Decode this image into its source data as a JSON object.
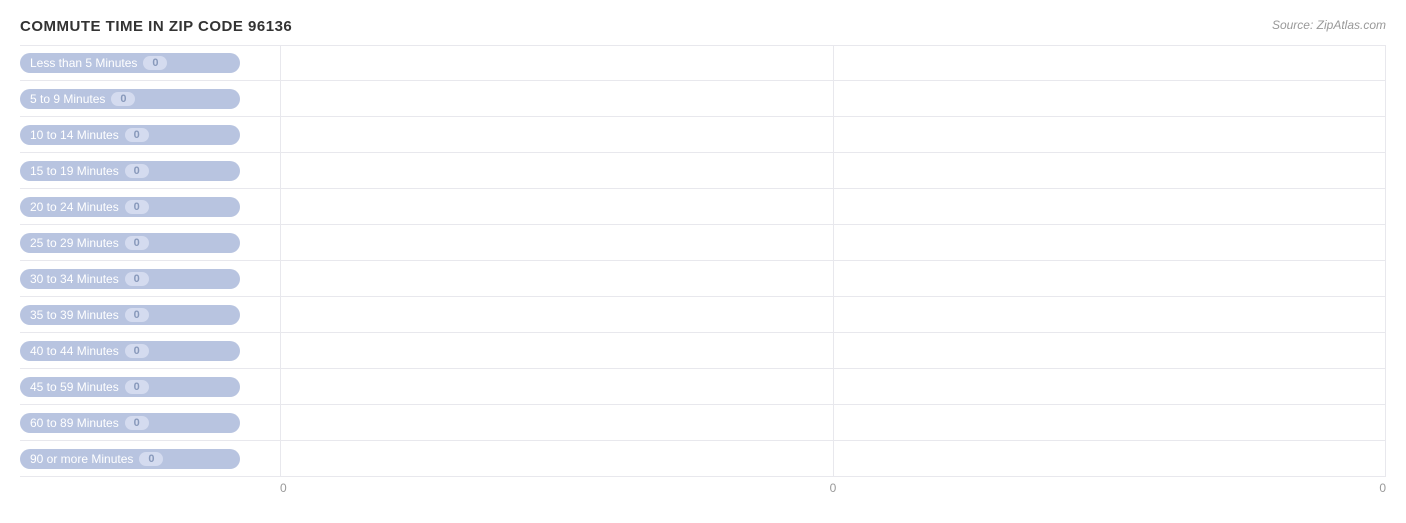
{
  "chart": {
    "title": "COMMUTE TIME IN ZIP CODE 96136",
    "source": "Source: ZipAtlas.com",
    "bars": [
      {
        "label": "Less than 5 Minutes",
        "value": 0
      },
      {
        "label": "5 to 9 Minutes",
        "value": 0
      },
      {
        "label": "10 to 14 Minutes",
        "value": 0
      },
      {
        "label": "15 to 19 Minutes",
        "value": 0
      },
      {
        "label": "20 to 24 Minutes",
        "value": 0
      },
      {
        "label": "25 to 29 Minutes",
        "value": 0
      },
      {
        "label": "30 to 34 Minutes",
        "value": 0
      },
      {
        "label": "35 to 39 Minutes",
        "value": 0
      },
      {
        "label": "40 to 44 Minutes",
        "value": 0
      },
      {
        "label": "45 to 59 Minutes",
        "value": 0
      },
      {
        "label": "60 to 89 Minutes",
        "value": 0
      },
      {
        "label": "90 or more Minutes",
        "value": 0
      }
    ],
    "x_axis_labels": [
      "0",
      "0",
      "0"
    ]
  }
}
